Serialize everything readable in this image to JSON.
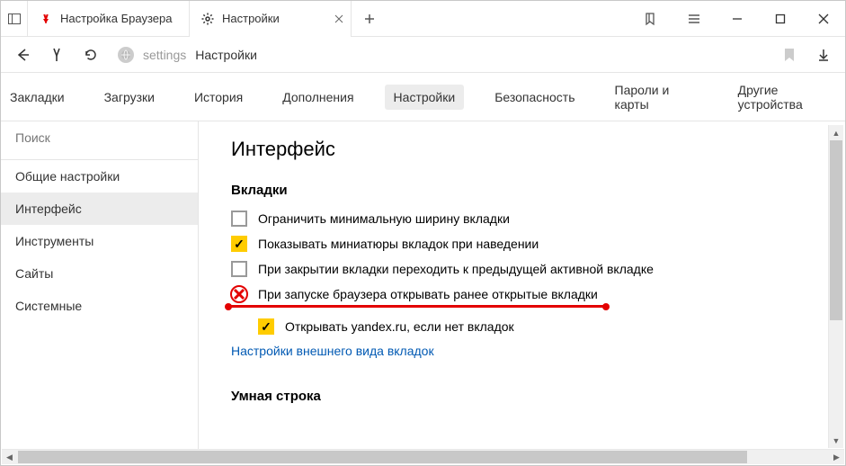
{
  "titlebar": {
    "tabs": [
      {
        "label": "Настройка Браузера",
        "icon": "yandex"
      },
      {
        "label": "Настройки",
        "icon": "gear",
        "active": true
      }
    ]
  },
  "address": {
    "host": "settings",
    "path": "Настройки"
  },
  "settings_tabs": [
    "Закладки",
    "Загрузки",
    "История",
    "Дополнения",
    "Настройки",
    "Безопасность",
    "Пароли и карты",
    "Другие устройства"
  ],
  "settings_tabs_active": 4,
  "sidebar": {
    "search_placeholder": "Поиск",
    "items": [
      "Общие настройки",
      "Интерфейс",
      "Инструменты",
      "Сайты",
      "Системные"
    ],
    "active": 1
  },
  "main": {
    "title": "Интерфейс",
    "section_tabs": "Вкладки",
    "checks": [
      {
        "label": "Ограничить минимальную ширину вкладки",
        "checked": false
      },
      {
        "label": "Показывать миниатюры вкладок при наведении",
        "checked": true
      },
      {
        "label": "При закрытии вкладки переходить к предыдущей активной вкладке",
        "checked": false
      },
      {
        "label": "При запуске браузера открывать ранее открытые вкладки",
        "checked": false,
        "x_annot": true
      },
      {
        "label": "Открывать yandex.ru, если нет вкладок",
        "checked": true,
        "indent": true
      }
    ],
    "tabs_appearance_link": "Настройки внешнего вида вкладок",
    "section_smart": "Умная строка"
  }
}
